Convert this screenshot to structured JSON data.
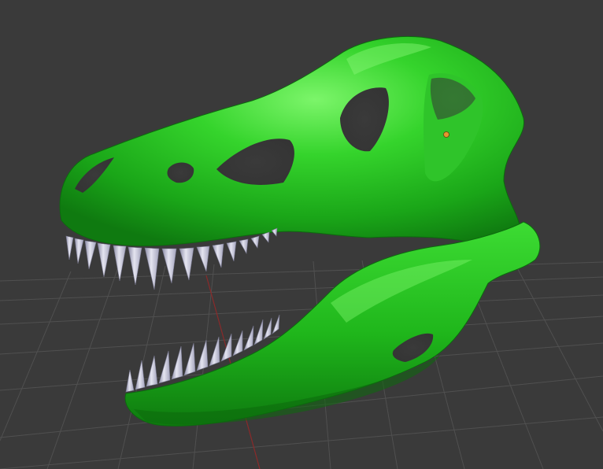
{
  "viewport": {
    "background_color": "#3a3a3a",
    "grid_line_color": "#505050",
    "x_axis_color": "#8a2a2a",
    "origin_marker_color": "#e8962e"
  },
  "model": {
    "name_icon": "trex-skull-model",
    "material_color": "#22c41e",
    "material_highlight": "#7cf56a",
    "material_shadow": "#0f7a10",
    "teeth_color": "#d8d8e8",
    "teeth_shadow": "#8e8ea8"
  }
}
